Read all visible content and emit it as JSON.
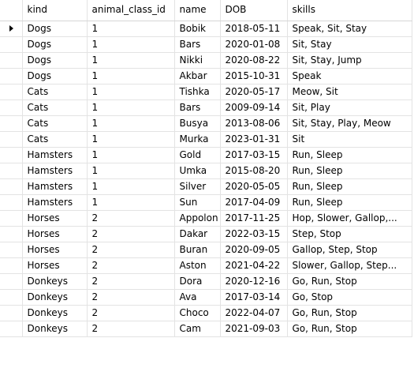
{
  "grid": {
    "columns": [
      "kind",
      "animal_class_id",
      "name",
      "DOB",
      "skills"
    ],
    "current_row_index": 0,
    "rows": [
      [
        "Dogs",
        "1",
        "Bobik",
        "2018-05-11",
        "Speak, Sit, Stay"
      ],
      [
        "Dogs",
        "1",
        "Bars",
        "2020-01-08",
        "Sit, Stay"
      ],
      [
        "Dogs",
        "1",
        "Nikki",
        "2020-08-22",
        "Sit, Stay, Jump"
      ],
      [
        "Dogs",
        "1",
        "Akbar",
        "2015-10-31",
        "Speak"
      ],
      [
        "Cats",
        "1",
        "Tishka",
        "2020-05-17",
        "Meow, Sit"
      ],
      [
        "Cats",
        "1",
        "Bars",
        "2009-09-14",
        "Sit, Play"
      ],
      [
        "Cats",
        "1",
        "Busya",
        "2013-08-06",
        "Sit, Stay, Play, Meow"
      ],
      [
        "Cats",
        "1",
        "Murka",
        "2023-01-31",
        "Sit"
      ],
      [
        "Hamsters",
        "1",
        "Gold",
        "2017-03-15",
        "Run, Sleep"
      ],
      [
        "Hamsters",
        "1",
        "Umka",
        "2015-08-20",
        "Run, Sleep"
      ],
      [
        "Hamsters",
        "1",
        "Silver",
        "2020-05-05",
        "Run, Sleep"
      ],
      [
        "Hamsters",
        "1",
        "Sun",
        "2017-04-09",
        "Run, Sleep"
      ],
      [
        "Horses",
        "2",
        "Appolon",
        "2017-11-25",
        "Hop, Slower, Gallop,..."
      ],
      [
        "Horses",
        "2",
        "Dakar",
        "2022-03-15",
        "Step, Stop"
      ],
      [
        "Horses",
        "2",
        "Buran",
        "2020-09-05",
        "Gallop, Step, Stop"
      ],
      [
        "Horses",
        "2",
        "Aston",
        "2021-04-22",
        "Slower, Gallop, Step..."
      ],
      [
        "Donkeys",
        "2",
        "Dora",
        "2020-12-16",
        "Go, Run, Stop"
      ],
      [
        "Donkeys",
        "2",
        "Ava",
        "2017-03-14",
        "Go, Stop"
      ],
      [
        "Donkeys",
        "2",
        "Choco",
        "2022-04-07",
        "Go, Run, Stop"
      ],
      [
        "Donkeys",
        "2",
        "Cam",
        "2021-09-03",
        "Go, Run, Stop"
      ]
    ]
  },
  "icons": {
    "current_row": "right-arrow-icon"
  }
}
